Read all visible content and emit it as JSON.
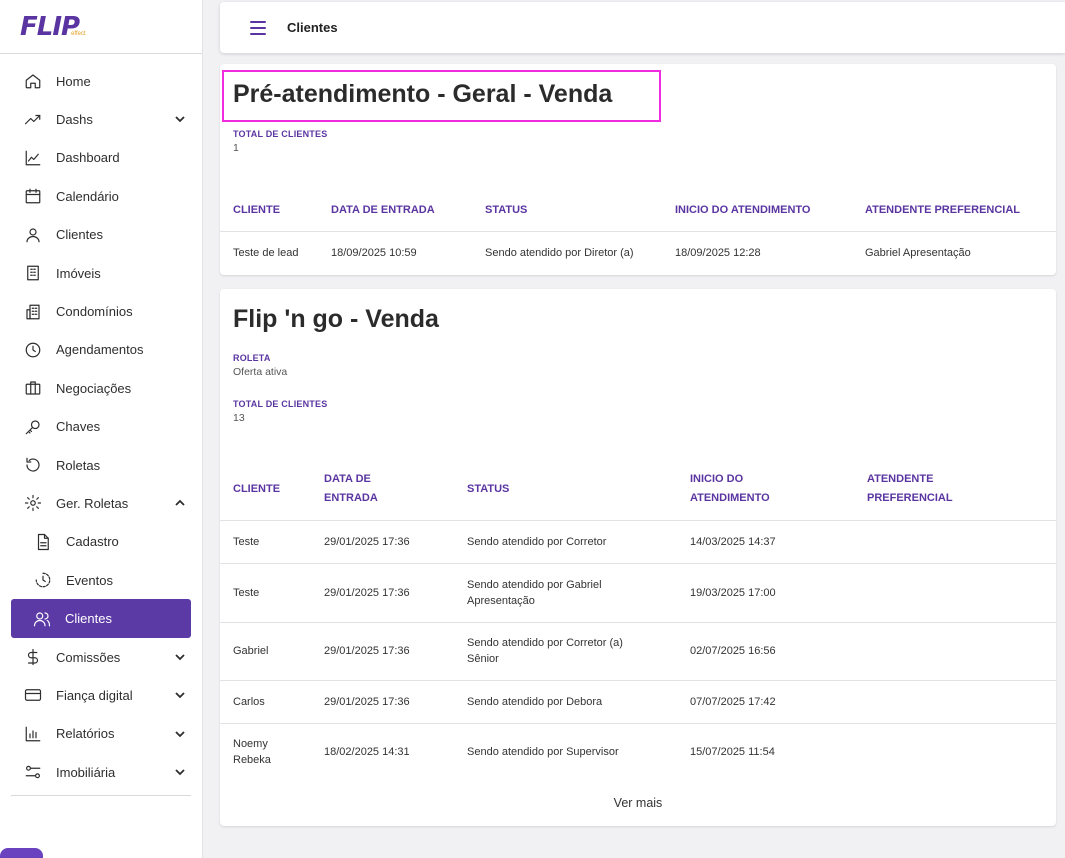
{
  "brand": {
    "logo": "FLIP",
    "logo_sub": "effect"
  },
  "sidebar": {
    "items": [
      {
        "label": "Home",
        "icon": "home-icon"
      },
      {
        "label": "Dashs",
        "icon": "trending-up-icon"
      },
      {
        "label": "Dashboard",
        "icon": "line-chart-icon"
      },
      {
        "label": "Calendário",
        "icon": "calendar-icon"
      },
      {
        "label": "Clientes",
        "icon": "user-icon"
      },
      {
        "label": "Imóveis",
        "icon": "building-icon"
      },
      {
        "label": "Condomínios",
        "icon": "condo-icon"
      },
      {
        "label": "Agendamentos",
        "icon": "clock-icon"
      },
      {
        "label": "Negociações",
        "icon": "briefcase-icon"
      },
      {
        "label": "Chaves",
        "icon": "key-icon"
      },
      {
        "label": "Roletas",
        "icon": "rotate-icon"
      },
      {
        "label": "Ger. Roletas",
        "icon": "gear-icon"
      },
      {
        "label": "Cadastro",
        "icon": "document-icon"
      },
      {
        "label": "Eventos",
        "icon": "history-icon"
      },
      {
        "label": "Clientes",
        "icon": "users-icon"
      },
      {
        "label": "Comissões",
        "icon": "dollar-icon"
      },
      {
        "label": "Fiança digital",
        "icon": "credit-card-icon"
      },
      {
        "label": "Relatórios",
        "icon": "bar-chart-icon"
      },
      {
        "label": "Imobiliária",
        "icon": "sliders-icon"
      }
    ]
  },
  "topbar": {
    "title": "Clientes"
  },
  "card1": {
    "title": "Pré-atendimento - Geral - Venda",
    "total_label": "TOTAL DE CLIENTES",
    "total_value": "1",
    "columns": [
      "CLIENTE",
      "DATA DE ENTRADA",
      "STATUS",
      "INICIO DO ATENDIMENTO",
      "ATENDENTE PREFERENCIAL"
    ],
    "rows": [
      [
        "Teste de lead",
        "18/09/2025 10:59",
        "Sendo atendido por Diretor (a)",
        "18/09/2025 12:28",
        "Gabriel Apresentação"
      ]
    ]
  },
  "card2": {
    "title": "Flip 'n go - Venda",
    "roleta_label": "ROLETA",
    "roleta_value": "Oferta ativa",
    "total_label": "TOTAL DE CLIENTES",
    "total_value": "13",
    "columns": [
      "CLIENTE",
      "DATA DE ENTRADA",
      "STATUS",
      "INICIO DO ATENDIMENTO",
      "ATENDENTE PREFERENCIAL"
    ],
    "rows": [
      [
        "Teste",
        "29/01/2025 17:36",
        "Sendo atendido por Corretor",
        "14/03/2025 14:37",
        ""
      ],
      [
        "Teste",
        "29/01/2025 17:36",
        "Sendo atendido por Gabriel Apresentação",
        "19/03/2025 17:00",
        ""
      ],
      [
        "Gabriel",
        "29/01/2025 17:36",
        "Sendo atendido por Corretor (a) Sênior",
        "02/07/2025 16:56",
        ""
      ],
      [
        "Carlos",
        "29/01/2025 17:36",
        "Sendo atendido por Debora",
        "07/07/2025 17:42",
        ""
      ],
      [
        "Noemy Rebeka",
        "18/02/2025 14:31",
        "Sendo atendido por Supervisor",
        "15/07/2025 11:54",
        ""
      ]
    ],
    "ver_mais": "Ver mais"
  }
}
